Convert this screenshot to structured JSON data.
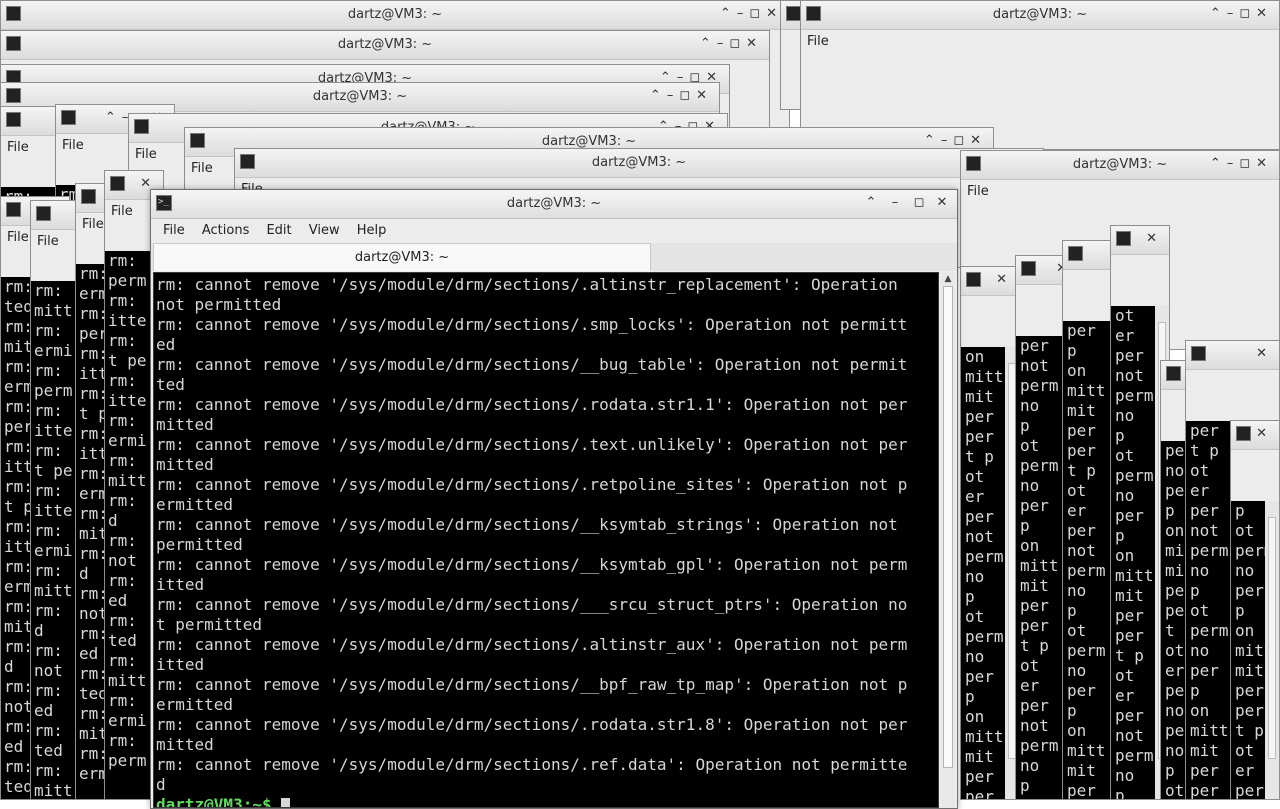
{
  "window": {
    "title": "dartz@VM3: ~",
    "controls": {
      "chevron": "⌃",
      "minimize": "–",
      "maximize": "◻",
      "close": "✕"
    },
    "menu": [
      "File",
      "Actions",
      "Edit",
      "View",
      "Help"
    ],
    "tab_label": "dartz@VM3: ~"
  },
  "terminal": {
    "lines": [
      "rm: cannot remove '/sys/module/drm/sections/.altinstr_replacement': Operation",
      "not permitted",
      "rm: cannot remove '/sys/module/drm/sections/.smp_locks': Operation not permitt",
      "ed",
      "rm: cannot remove '/sys/module/drm/sections/__bug_table': Operation not permit",
      "ted",
      "rm: cannot remove '/sys/module/drm/sections/.rodata.str1.1': Operation not per",
      "mitted",
      "rm: cannot remove '/sys/module/drm/sections/.text.unlikely': Operation not per",
      "mitted",
      "rm: cannot remove '/sys/module/drm/sections/.retpoline_sites': Operation not p",
      "ermitted",
      "rm: cannot remove '/sys/module/drm/sections/__ksymtab_strings': Operation not",
      "permitted",
      "rm: cannot remove '/sys/module/drm/sections/__ksymtab_gpl': Operation not perm",
      "itted",
      "rm: cannot remove '/sys/module/drm/sections/___srcu_struct_ptrs': Operation no",
      "t permitted",
      "rm: cannot remove '/sys/module/drm/sections/.altinstr_aux': Operation not perm",
      "itted",
      "rm: cannot remove '/sys/module/drm/sections/__bpf_raw_tp_map': Operation not p",
      "ermitted",
      "rm: cannot remove '/sys/module/drm/sections/.rodata.str1.8': Operation not per",
      "mitted",
      "rm: cannot remove '/sys/module/drm/sections/.ref.data': Operation not permitte",
      "d"
    ],
    "prompt": "dartz@VM3:~$",
    "scroll_up_arrow": "▲"
  },
  "background_windows": {
    "title": "dartz@VM3: ~",
    "menu_file": "File",
    "menu_actions": "Actions",
    "left_fragments": [
      "rm:",
      "not",
      "rm:",
      "ed",
      "rm:",
      "ted",
      "rm:",
      "mitt",
      "rm:",
      "ermi",
      "rm:",
      "perm",
      "rm:",
      "itte",
      "rm:",
      "t pe",
      "rm:",
      "itte",
      "rm:",
      "ermi",
      "rm:",
      "mitt",
      "rm:",
      "d"
    ],
    "right_fragments": [
      "on",
      "mitt",
      "mit",
      "per",
      "per",
      "t p",
      "ot",
      "er",
      "per",
      "not",
      "perm",
      "no",
      "p",
      "ot",
      "perm",
      "no",
      "per",
      "p"
    ]
  },
  "colors": {
    "terminal_bg": "#000000",
    "terminal_fg": "#d6d6d6",
    "prompt": "#5fdc5f",
    "chrome": "#ececec"
  }
}
